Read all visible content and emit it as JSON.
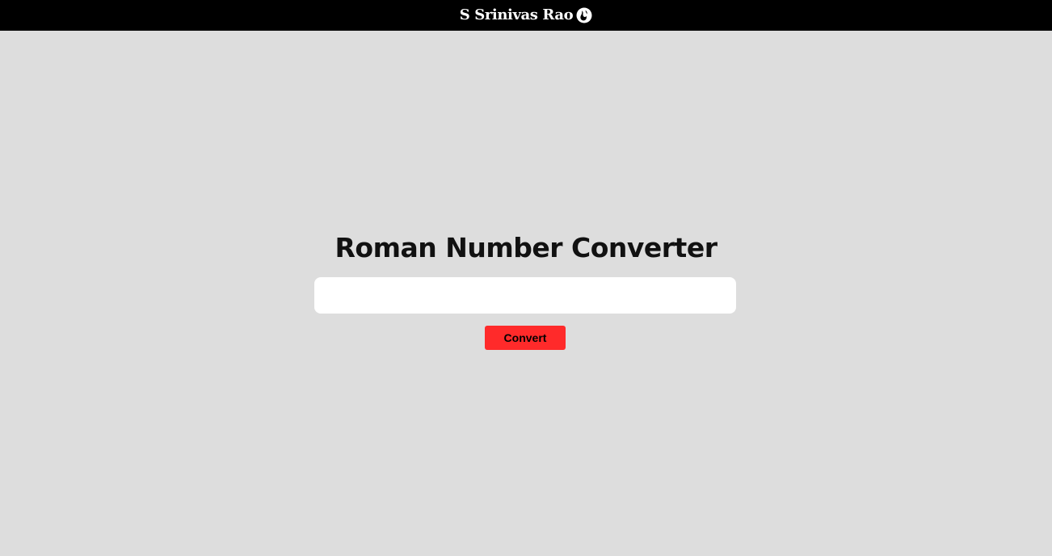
{
  "header": {
    "brand_name": "S Srinivas Rao",
    "brand_icon": "flame-logo-icon"
  },
  "main": {
    "title": "Roman Number Converter",
    "input": {
      "value": "",
      "placeholder": ""
    },
    "convert_label": "Convert"
  },
  "colors": {
    "header_bg": "#000000",
    "page_bg": "#dddddd",
    "button_bg": "#ff2a2a",
    "input_bg": "#ffffff"
  }
}
